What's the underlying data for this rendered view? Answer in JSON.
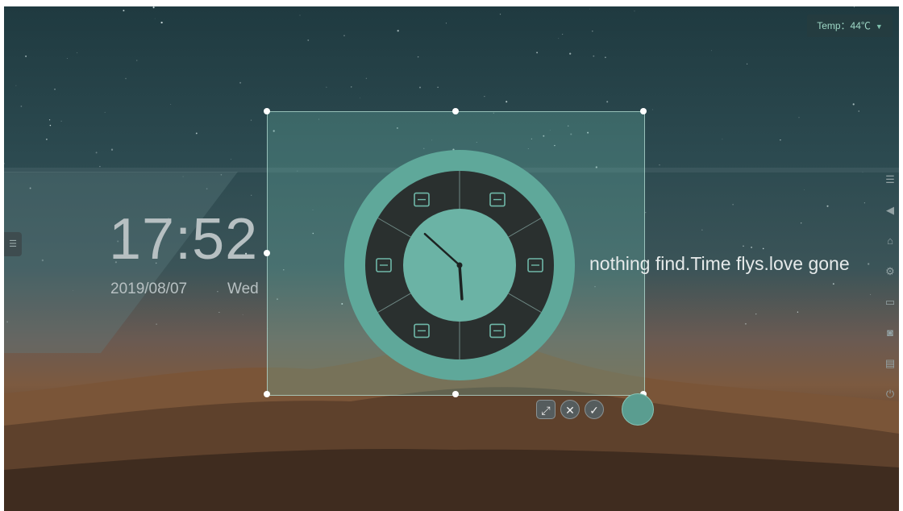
{
  "status": {
    "temp_label": "Temp：44℃",
    "temp_icon": "drop-icon"
  },
  "clock": {
    "time": "17:52",
    "date": "2019/08/07",
    "weekday": "Wed",
    "hour": 17,
    "minute": 52
  },
  "quote": "nothing find.Time flys.love gone",
  "widget": {
    "ring_color": "#5fa89a",
    "inner_color": "#6bb3a5",
    "dark_color": "#2a302f",
    "segments": [
      "gallery-icon",
      "browser-icon",
      "apps-icon",
      "cast-icon",
      "file-manager-icon",
      "calendar-icon"
    ]
  },
  "toolbar": {
    "buttons": [
      "resize-icon",
      "close-icon",
      "confirm-icon"
    ]
  },
  "sidebar": {
    "icons": [
      "sidebar-menu-icon",
      "back-icon",
      "home-icon",
      "settings-icon",
      "folder-icon",
      "screenshot-icon",
      "keyboard-icon",
      "power-icon"
    ]
  }
}
